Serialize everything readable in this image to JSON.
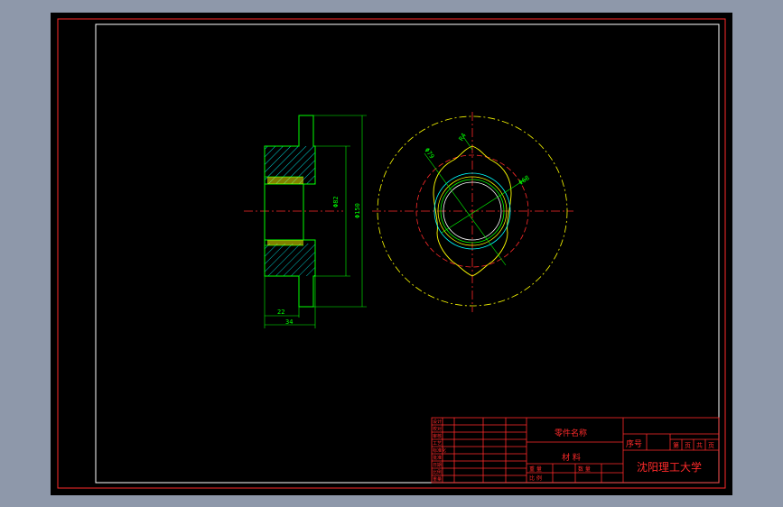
{
  "colors": {
    "background": "#8e98aa",
    "sheet": "#000000",
    "border": "#ff2a2a",
    "inner_frame": "#ffffff",
    "dimension": "#00ff00",
    "centerline": "#ff2a2a",
    "yellow_outline": "#ffff00",
    "cyan_detail": "#00ffff"
  },
  "dimensions": {
    "flange_thickness": "22",
    "total_width": "34",
    "bore_diameter": "Φ82",
    "outer_diameter": "Φ150",
    "radius_label": "R4",
    "diameter_a": "Φ79",
    "diameter_b": "Φ68"
  },
  "title_block": {
    "part_name": "零件名称",
    "material": "材  料",
    "serial_no": "序号",
    "school": "沈阳理工大学",
    "sheet_info": [
      "第",
      "页",
      "共",
      "页"
    ],
    "scale_label": "比  例",
    "weight_label": "重  量",
    "quantity_label": "数  量",
    "left_rows": [
      "设计",
      "校对",
      "审核",
      "工艺",
      "标准化",
      "批准",
      "日期",
      "比例",
      "重量"
    ]
  }
}
